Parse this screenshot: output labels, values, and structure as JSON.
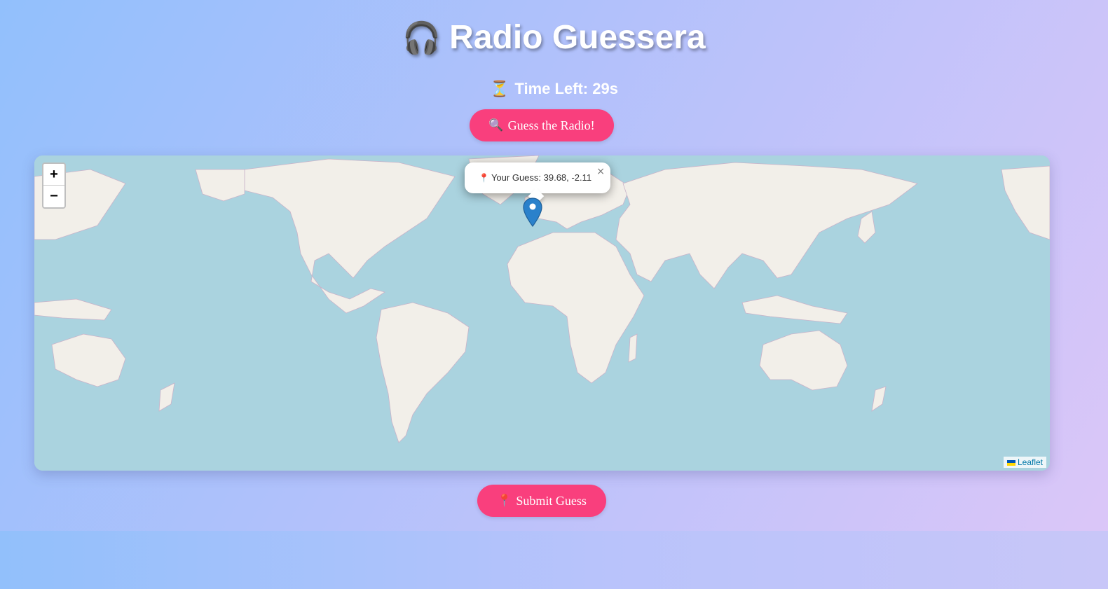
{
  "app": {
    "title": "Radio Guessera",
    "title_icon": "🎧"
  },
  "timer": {
    "icon": "⏳",
    "text": "Time Left: 29s"
  },
  "guess_button": {
    "icon": "🔍",
    "label": "Guess the Radio!"
  },
  "map": {
    "zoom_in_label": "+",
    "zoom_out_label": "−",
    "popup": {
      "icon": "📍",
      "text": "Your Guess: 39.68, -2.11",
      "close_label": "×"
    },
    "marker": {
      "lat": 39.68,
      "lng": -2.11
    },
    "attribution": "Leaflet",
    "colors": {
      "water": "#aad3df",
      "land": "#f2efe9",
      "border": "#c2a7c4",
      "marker": "#2a81cb"
    }
  },
  "submit_button": {
    "icon": "📍",
    "label": "Submit Guess"
  },
  "colors": {
    "button": "#f93f7d",
    "title_text": "#ffffff"
  }
}
